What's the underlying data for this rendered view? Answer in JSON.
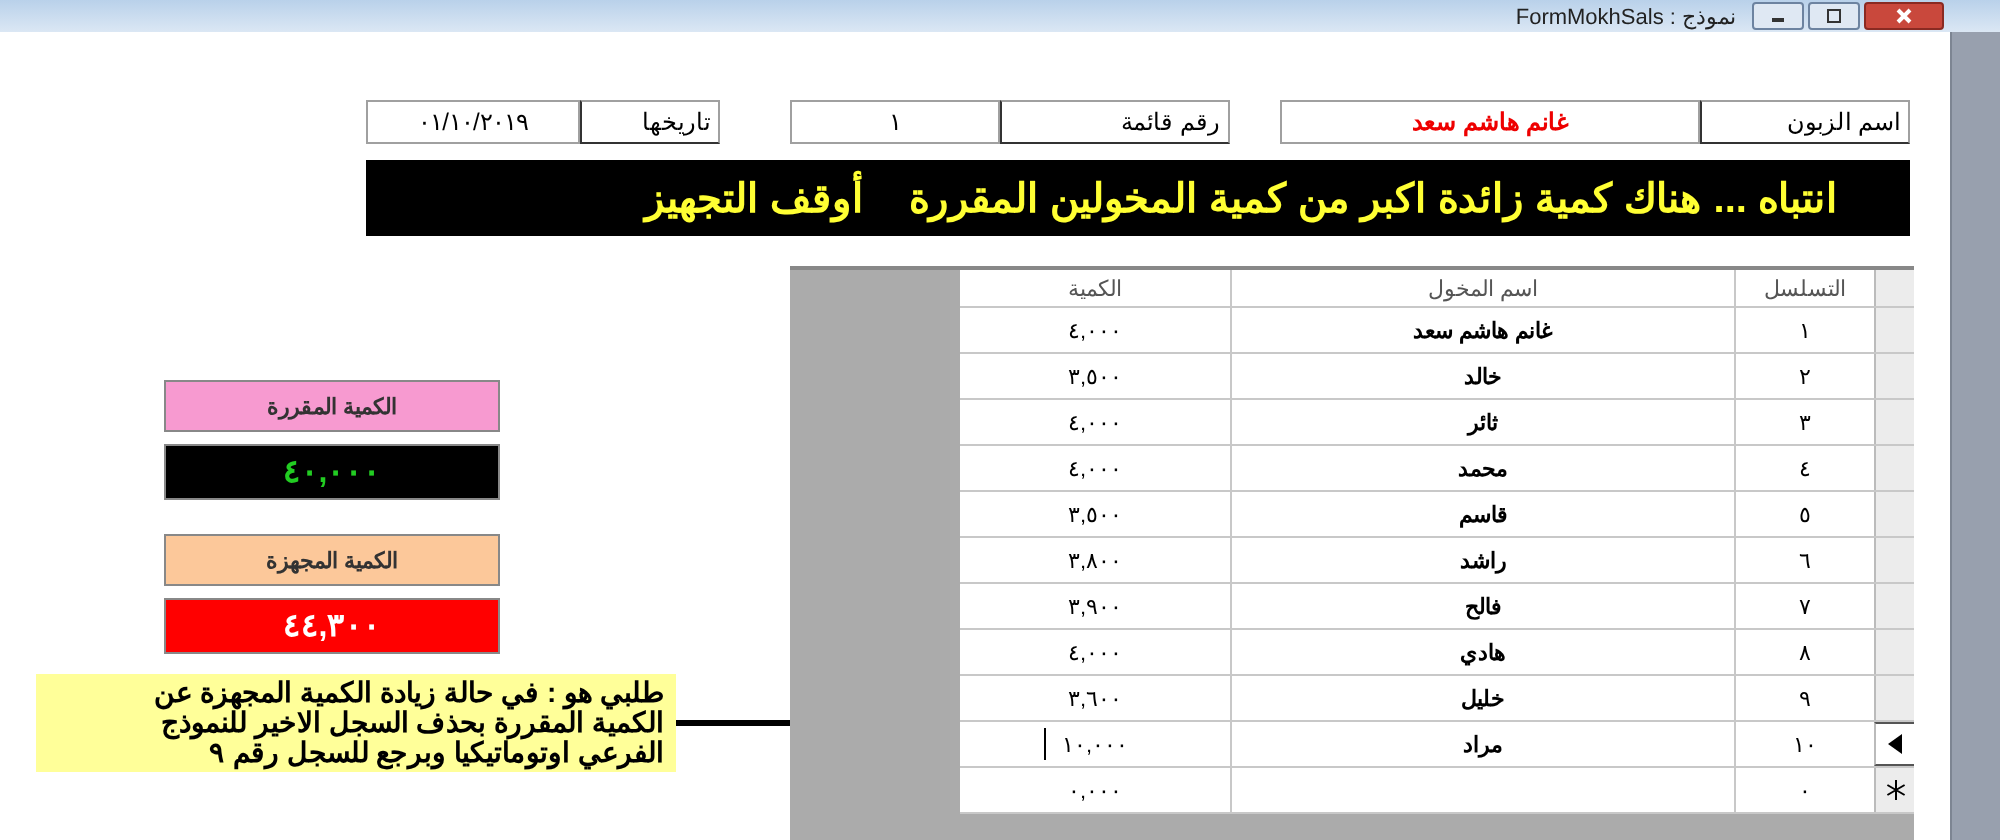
{
  "window": {
    "title": "FormMokhSals : نموذج"
  },
  "header": {
    "customer_label": "اسم الزبون",
    "customer_value": "غانم هاشم سعد",
    "list_label": "رقم قائمة",
    "list_value": "١",
    "date_label": "تاريخها",
    "date_value": "٠١/١٠/٢٠١٩"
  },
  "warning": "انتباه ... هناك كمية زائدة اكبر من كمية المخولين المقررة    أوقف التجهيز",
  "table": {
    "columns": [
      "التسلسل",
      "اسم المخول",
      "الكمية"
    ],
    "rows": [
      {
        "kind": "record",
        "selected": false,
        "cells": [
          "١",
          "غانم هاشم سعد",
          "٤,٠٠٠"
        ]
      },
      {
        "kind": "record",
        "selected": false,
        "cells": [
          "٢",
          "خالد",
          "٣,٥٠٠"
        ]
      },
      {
        "kind": "record",
        "selected": false,
        "cells": [
          "٣",
          "ثائر",
          "٤,٠٠٠"
        ]
      },
      {
        "kind": "record",
        "selected": false,
        "cells": [
          "٤",
          "محمد",
          "٤,٠٠٠"
        ]
      },
      {
        "kind": "record",
        "selected": false,
        "cells": [
          "٥",
          "قاسم",
          "٣,٥٠٠"
        ]
      },
      {
        "kind": "record",
        "selected": false,
        "cells": [
          "٦",
          "راشد",
          "٣,٨٠٠"
        ]
      },
      {
        "kind": "record",
        "selected": false,
        "cells": [
          "٧",
          "فالح",
          "٣,٩٠٠"
        ]
      },
      {
        "kind": "record",
        "selected": false,
        "cells": [
          "٨",
          "هادي",
          "٤,٠٠٠"
        ]
      },
      {
        "kind": "record",
        "selected": false,
        "cells": [
          "٩",
          "خليل",
          "٣,٦٠٠"
        ]
      },
      {
        "kind": "record",
        "selected": true,
        "cells": [
          "١٠",
          "مراد",
          "١٠,٠٠٠"
        ]
      },
      {
        "kind": "new",
        "selected": false,
        "cells": [
          "٠",
          "",
          "٠,٠٠٠"
        ]
      }
    ]
  },
  "totals": [
    {
      "kind": "allotted",
      "label": "الكمية المقررة",
      "value": "٤٠,٠٠٠"
    },
    {
      "kind": "supplied",
      "label": "الكمية المجهزة",
      "value": "٤٤,٣٠٠"
    }
  ],
  "note": "طلبي هو : في حالة زيادة الكمية المجهزة عن الكمية المقررة بحذف السجل الاخير للنموذج الفرعي اوتوماتيكيا وبرجع للسجل رقم ٩"
}
